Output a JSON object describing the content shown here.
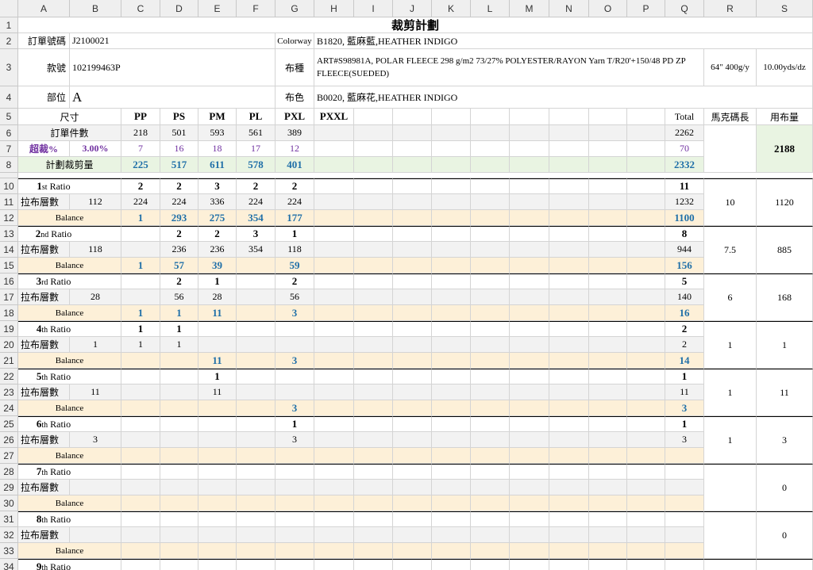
{
  "columns": [
    "A",
    "B",
    "C",
    "D",
    "E",
    "F",
    "G",
    "H",
    "I",
    "J",
    "K",
    "L",
    "M",
    "N",
    "O",
    "P",
    "Q",
    "R",
    "S"
  ],
  "rows": [
    "1",
    "2",
    "3",
    "4",
    "5",
    "6",
    "7",
    "8",
    "10",
    "11",
    "12",
    "13",
    "14",
    "15",
    "16",
    "17",
    "18",
    "19",
    "20",
    "21",
    "22",
    "23",
    "24",
    "25",
    "26",
    "27",
    "28",
    "29",
    "30",
    "31",
    "32",
    "33",
    "34"
  ],
  "header": {
    "title": "裁剪計劃",
    "order_no_label": "訂單號碼",
    "order_no": "J2100021",
    "style_label": "款號",
    "style": "102199463P",
    "part_label": "部位",
    "part": "A",
    "colorway_label": "Colorway",
    "colorway": "B1820, 藍麻藍,HEATHER INDIGO",
    "fabric_label": "布種",
    "fabric": "ART#S98981A, POLAR FLEECE 298 g/m2 73/27% POLYESTER/RAYON Yarn T/R20'+150/48 PD ZP FLEECE(SUEDED)",
    "fabric_spec": "64\" 400g/y",
    "fabric_yield": "10.00yds/dz",
    "color_label": "布色",
    "color": "B0020, 藍麻花,HEATHER INDIGO"
  },
  "sizes": {
    "label": "尺寸",
    "list": [
      "PP",
      "PS",
      "PM",
      "PL",
      "PXL",
      "PXXL"
    ],
    "total_label": "Total",
    "marker_label": "馬克碼長",
    "usage_label": "用布量"
  },
  "order": {
    "label": "訂單件數",
    "values": [
      "218",
      "501",
      "593",
      "561",
      "389"
    ],
    "total": "2262",
    "over_label": "超裁%",
    "over_pct": "3.00%",
    "over_values": [
      "7",
      "16",
      "18",
      "17",
      "12"
    ],
    "over_total": "70",
    "plan_label": "計劃裁剪量",
    "plan_values": [
      "225",
      "517",
      "611",
      "578",
      "401"
    ],
    "plan_total": "2332",
    "usage": "2188"
  },
  "ratios": [
    {
      "num": "1",
      "sup": "st",
      "word": "Ratio",
      "ratio": [
        "2",
        "2",
        "3",
        "2",
        "2"
      ],
      "ratio_total": "11",
      "layers_label": "拉布層數",
      "layers": "112",
      "qty": [
        "224",
        "224",
        "336",
        "224",
        "224"
      ],
      "qty_total": "1232",
      "marker": "10",
      "usage": "1120",
      "balance_label": "Balance",
      "balance": [
        "1",
        "293",
        "275",
        "354",
        "177"
      ],
      "balance_total": "1100"
    },
    {
      "num": "2",
      "sup": "nd",
      "word": "Ratio",
      "ratio": [
        "",
        "2",
        "2",
        "3",
        "1"
      ],
      "ratio_total": "8",
      "layers_label": "拉布層數",
      "layers": "118",
      "qty": [
        "",
        "236",
        "236",
        "354",
        "118"
      ],
      "qty_total": "944",
      "marker": "7.5",
      "usage": "885",
      "balance_label": "Balance",
      "balance": [
        "1",
        "57",
        "39",
        "",
        "59"
      ],
      "balance_total": "156"
    },
    {
      "num": "3",
      "sup": "rd",
      "word": "Ratio",
      "ratio": [
        "",
        "2",
        "1",
        "",
        "2"
      ],
      "ratio_total": "5",
      "layers_label": "拉布層數",
      "layers": "28",
      "qty": [
        "",
        "56",
        "28",
        "",
        "56"
      ],
      "qty_total": "140",
      "marker": "6",
      "usage": "168",
      "balance_label": "Balance",
      "balance": [
        "1",
        "1",
        "11",
        "",
        "3"
      ],
      "balance_total": "16"
    },
    {
      "num": "4",
      "sup": "th",
      "word": "Ratio",
      "ratio": [
        "1",
        "1",
        "",
        "",
        ""
      ],
      "ratio_total": "2",
      "layers_label": "拉布層數",
      "layers": "1",
      "qty": [
        "1",
        "1",
        "",
        "",
        ""
      ],
      "qty_total": "2",
      "marker": "1",
      "usage": "1",
      "balance_label": "Balance",
      "balance": [
        "",
        "",
        "11",
        "",
        "3"
      ],
      "balance_total": "14"
    },
    {
      "num": "5",
      "sup": "th",
      "word": "Ratio",
      "ratio": [
        "",
        "",
        "1",
        "",
        ""
      ],
      "ratio_total": "1",
      "layers_label": "拉布層數",
      "layers": "11",
      "qty": [
        "",
        "",
        "11",
        "",
        ""
      ],
      "qty_total": "11",
      "marker": "1",
      "usage": "11",
      "balance_label": "Balance",
      "balance": [
        "",
        "",
        "",
        "",
        "3"
      ],
      "balance_total": "3"
    },
    {
      "num": "6",
      "sup": "th",
      "word": "Ratio",
      "ratio": [
        "",
        "",
        "",
        "",
        "1"
      ],
      "ratio_total": "1",
      "layers_label": "拉布層數",
      "layers": "3",
      "qty": [
        "",
        "",
        "",
        "",
        "3"
      ],
      "qty_total": "3",
      "marker": "1",
      "usage": "3",
      "balance_label": "Balance",
      "balance": [
        "",
        "",
        "",
        "",
        ""
      ],
      "balance_total": ""
    },
    {
      "num": "7",
      "sup": "th",
      "word": "Ratio",
      "ratio": [
        "",
        "",
        "",
        "",
        ""
      ],
      "ratio_total": "",
      "layers_label": "拉布層數",
      "layers": "",
      "qty": [
        "",
        "",
        "",
        "",
        ""
      ],
      "qty_total": "",
      "marker": "",
      "usage": "0",
      "balance_label": "Balance",
      "balance": [
        "",
        "",
        "",
        "",
        ""
      ],
      "balance_total": ""
    },
    {
      "num": "8",
      "sup": "th",
      "word": "Ratio",
      "ratio": [
        "",
        "",
        "",
        "",
        ""
      ],
      "ratio_total": "",
      "layers_label": "拉布層數",
      "layers": "",
      "qty": [
        "",
        "",
        "",
        "",
        ""
      ],
      "qty_total": "",
      "marker": "",
      "usage": "0",
      "balance_label": "Balance",
      "balance": [
        "",
        "",
        "",
        "",
        ""
      ],
      "balance_total": ""
    },
    {
      "num": "9",
      "sup": "th",
      "word": "Ratio"
    }
  ],
  "colors": {
    "balance_bg": "#fdf0d8",
    "plan_bg": "#e9f4e2",
    "row_alt_bg": "#f2f2f2",
    "blue_text": "#1f6fa8",
    "purple_text": "#7030a0"
  }
}
